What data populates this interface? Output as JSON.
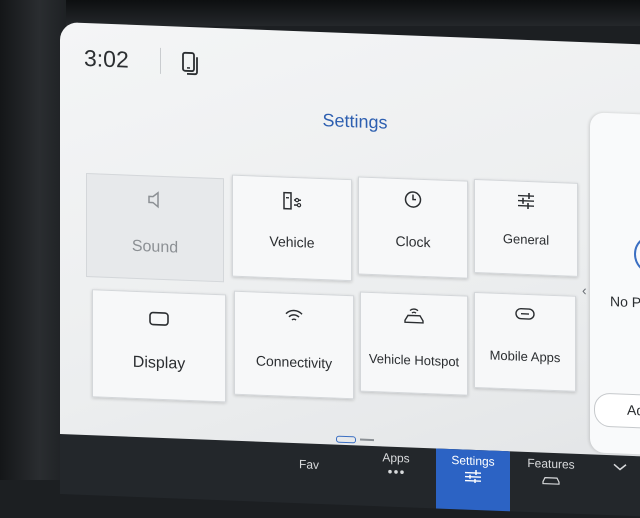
{
  "status_bar": {
    "time": "3:02",
    "phone_icon": "phone-projection-icon"
  },
  "page": {
    "title": "Settings"
  },
  "tiles": [
    {
      "label": "Sound",
      "icon": "speaker-icon",
      "disabled": true
    },
    {
      "label": "Vehicle",
      "icon": "vehicle-settings-icon"
    },
    {
      "label": "Clock",
      "icon": "clock-icon"
    },
    {
      "label": "General",
      "icon": "sliders-icon"
    },
    {
      "label": "Display",
      "icon": "display-icon"
    },
    {
      "label": "Connectivity",
      "icon": "wifi-icon"
    },
    {
      "label": "Vehicle Hotspot",
      "icon": "hotspot-icon"
    },
    {
      "label": "Mobile Apps",
      "icon": "link-icon"
    }
  ],
  "pager": {
    "pages": 2,
    "current": 1
  },
  "side_panel": {
    "text": "No Pa",
    "button_label": "Ad",
    "icon": "chevron-left-icon"
  },
  "nav": {
    "items": [
      {
        "label": "Fav"
      },
      {
        "label": "Apps",
        "icon": "dots-icon"
      },
      {
        "label": "Settings",
        "icon": "sliders-icon",
        "active": true
      },
      {
        "label": "Features",
        "icon": "car-icon"
      },
      {
        "label": "",
        "icon": "chevron-down-icon"
      }
    ]
  },
  "colors": {
    "accent": "#2c63c4",
    "title": "#2d5fb0",
    "nav_bg": "#23272b",
    "screen_bg": "#eceeef"
  }
}
